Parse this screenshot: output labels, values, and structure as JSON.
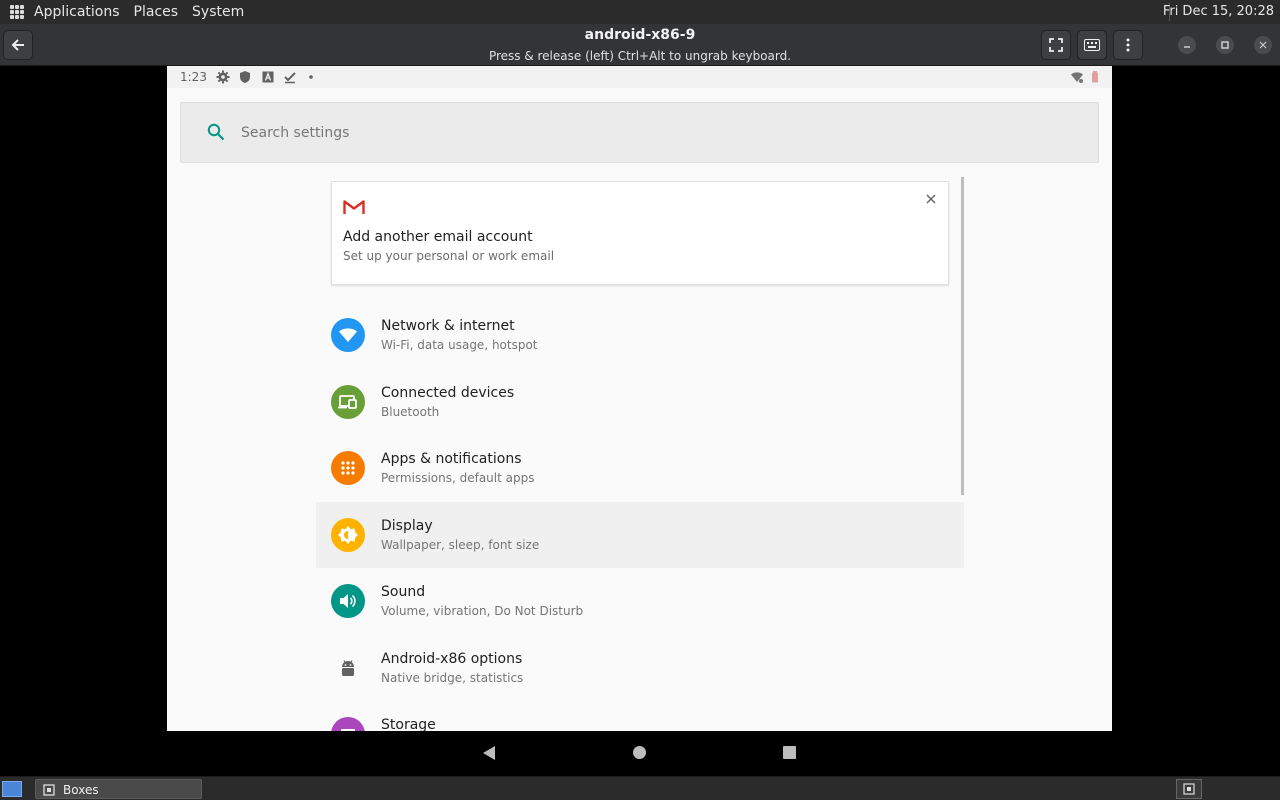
{
  "top_panel": {
    "menus": [
      "Applications",
      "Places",
      "System"
    ],
    "clock": "Fri Dec 15, 20:28"
  },
  "window": {
    "title": "android-x86-9",
    "subtitle": "Press & release (left) Ctrl+Alt to ungrab keyboard."
  },
  "android": {
    "status_time": "1:23",
    "search_placeholder": "Search settings",
    "suggestion": {
      "title": "Add another email account",
      "subtitle": "Set up your personal or work email"
    },
    "settings": [
      {
        "title": "Network & internet",
        "subtitle": "Wi-Fi, data usage, hotspot",
        "color": "#2196f3",
        "icon": "wifi-icon"
      },
      {
        "title": "Connected devices",
        "subtitle": "Bluetooth",
        "color": "#689f38",
        "icon": "devices-icon"
      },
      {
        "title": "Apps & notifications",
        "subtitle": "Permissions, default apps",
        "color": "#f57c00",
        "icon": "apps-icon"
      },
      {
        "title": "Display",
        "subtitle": "Wallpaper, sleep, font size",
        "color": "#ffb300",
        "icon": "brightness-icon"
      },
      {
        "title": "Sound",
        "subtitle": "Volume, vibration, Do Not Disturb",
        "color": "#009688",
        "icon": "volume-icon"
      },
      {
        "title": "Android-x86 options",
        "subtitle": "Native bridge, statistics",
        "color": "#ffffff",
        "icon": "android-icon"
      },
      {
        "title": "Storage",
        "subtitle": "",
        "color": "#ab47bc",
        "icon": "storage-icon"
      }
    ]
  },
  "taskbar": {
    "task_label": "Boxes"
  },
  "colors": {
    "panel_bg": "#2b2b2b",
    "header_bg": "#333436",
    "android_bg": "#fafafa",
    "search_accent": "#009688"
  }
}
